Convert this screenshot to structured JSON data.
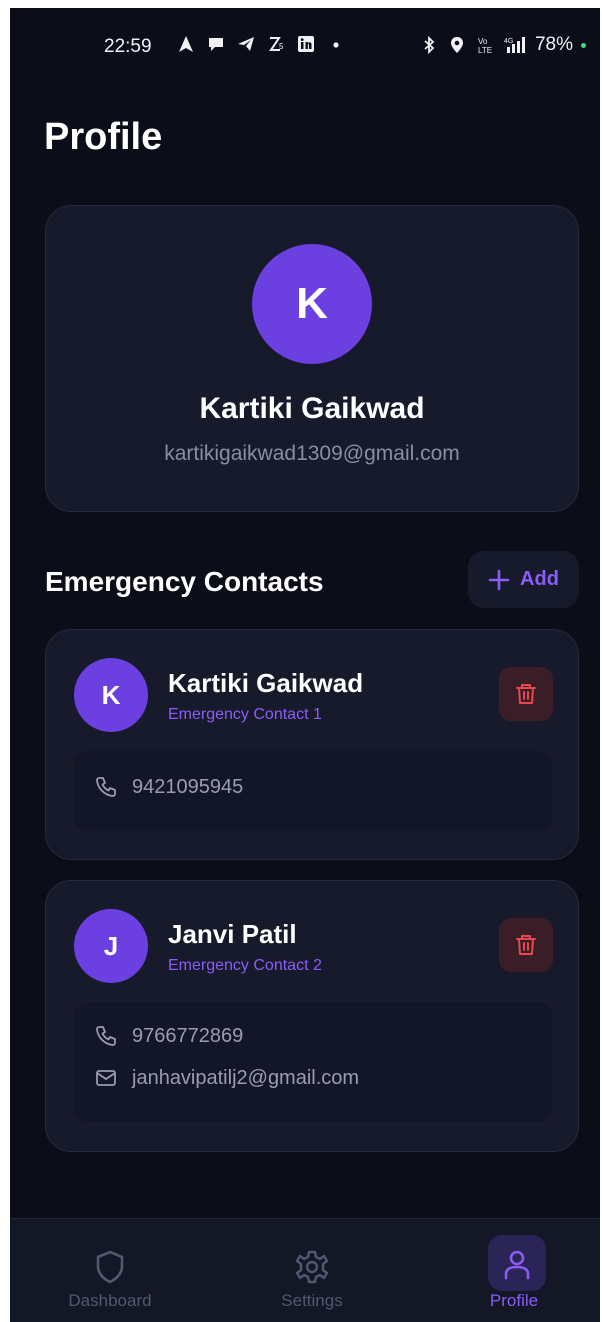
{
  "status_bar": {
    "time": "22:59",
    "battery": "78%",
    "left_icons": [
      "navigation-icon",
      "chat-icon",
      "telegram-icon",
      "zomato-icon",
      "linkedin-icon",
      "dot-icon"
    ],
    "right_icons": [
      "bluetooth-icon",
      "location-icon",
      "volte-icon",
      "signal-4g-icon"
    ]
  },
  "page": {
    "title": "Profile"
  },
  "profile": {
    "initial": "K",
    "name": "Kartiki Gaikwad",
    "email": "kartikigaikwad1309@gmail.com"
  },
  "emergency": {
    "title": "Emergency Contacts",
    "add_label": "Add",
    "contacts": [
      {
        "initial": "K",
        "name": "Kartiki Gaikwad",
        "subtitle": "Emergency Contact 1",
        "phone": "9421095945"
      },
      {
        "initial": "J",
        "name": "Janvi Patil",
        "subtitle": "Emergency Contact 2",
        "phone": "9766772869",
        "email": "janhavipatilj2@gmail.com"
      }
    ]
  },
  "nav": {
    "items": [
      {
        "label": "Dashboard",
        "icon": "shield-icon"
      },
      {
        "label": "Settings",
        "icon": "gear-icon"
      },
      {
        "label": "Profile",
        "icon": "user-icon",
        "active": true
      }
    ]
  },
  "colors": {
    "background": "#0b0d18",
    "card": "#171a2b",
    "accent": "#8b5cf6",
    "avatar": "#6c3fe0",
    "danger": "#e5484d"
  }
}
